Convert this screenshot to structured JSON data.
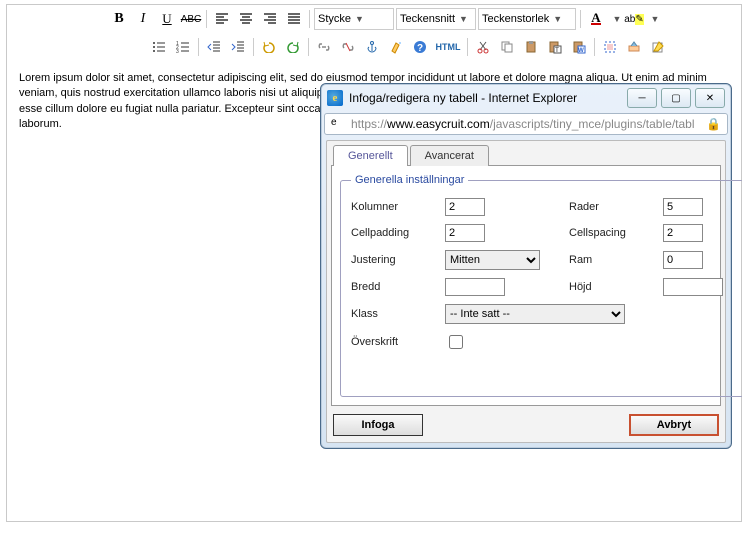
{
  "toolbar": {
    "style_dd": "Stycke",
    "font_dd": "Teckensnitt",
    "size_dd": "Teckenstorlek",
    "html_label": "HTML"
  },
  "content": {
    "text": "Lorem ipsum dolor sit amet, consectetur adipiscing elit, sed do eiusmod tempor incididunt ut labore et dolore magna aliqua. Ut enim ad minim veniam, quis nostrud exercitation ullamco laboris nisi ut aliquip ex ea commodo consequat. Duis aute irure dolor in reprehenderit in voluptate velit esse cillum dolore eu fugiat nulla pariatur. Excepteur sint occaecat cupidatat non proident, sunt in culpa qui officia deserunt mollit anim id est laborum."
  },
  "dialog": {
    "title": "Infoga/redigera ny tabell - Internet Explorer",
    "url_prefix": "https://",
    "url_domain": "www.easycruit.com",
    "url_path": "/javascripts/tiny_mce/plugins/table/tabl",
    "tabs": {
      "general": "Generellt",
      "advanced": "Avancerat"
    },
    "legend": "Generella inställningar",
    "labels": {
      "cols": "Kolumner",
      "rows": "Rader",
      "cellpadding": "Cellpadding",
      "cellspacing": "Cellspacing",
      "align": "Justering",
      "border": "Ram",
      "width": "Bredd",
      "height": "Höjd",
      "class": "Klass",
      "caption": "Överskrift"
    },
    "values": {
      "cols": "2",
      "rows": "5",
      "cellpadding": "2",
      "cellspacing": "2",
      "align": "Mitten",
      "border": "0",
      "width": "",
      "height": "",
      "class": "-- Inte satt --",
      "caption": false
    },
    "buttons": {
      "insert": "Infoga",
      "cancel": "Avbryt"
    }
  }
}
